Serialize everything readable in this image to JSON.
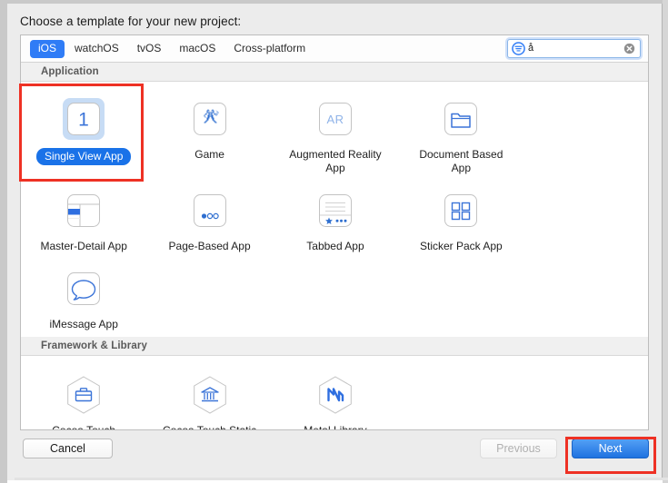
{
  "dialog": {
    "title": "Choose a template for your new project:"
  },
  "platform_tabs": {
    "items": [
      {
        "label": "iOS",
        "selected": true
      },
      {
        "label": "watchOS",
        "selected": false
      },
      {
        "label": "tvOS",
        "selected": false
      },
      {
        "label": "macOS",
        "selected": false
      },
      {
        "label": "Cross-platform",
        "selected": false
      }
    ]
  },
  "search": {
    "value": "å",
    "placeholder": "",
    "filter_icon": "filter-search-icon",
    "clear_icon": "clear-search-icon"
  },
  "sections": [
    {
      "header": "Application",
      "templates": [
        {
          "label": "Single View App",
          "icon": "single-view-app-icon",
          "selected": true
        },
        {
          "label": "Game",
          "icon": "game-icon",
          "selected": false
        },
        {
          "label": "Augmented Reality App",
          "icon": "augmented-reality-app-icon",
          "selected": false
        },
        {
          "label": "Document Based App",
          "icon": "document-based-app-icon",
          "selected": false
        },
        {
          "label": "Master-Detail App",
          "icon": "master-detail-app-icon",
          "selected": false
        },
        {
          "label": "Page-Based App",
          "icon": "page-based-app-icon",
          "selected": false
        },
        {
          "label": "Tabbed App",
          "icon": "tabbed-app-icon",
          "selected": false
        },
        {
          "label": "Sticker Pack App",
          "icon": "sticker-pack-app-icon",
          "selected": false
        },
        {
          "label": "iMessage App",
          "icon": "imessage-app-icon",
          "selected": false
        }
      ]
    },
    {
      "header": "Framework & Library",
      "templates": [
        {
          "label": "Cocoa Touch Framework",
          "icon": "cocoa-touch-framework-icon",
          "selected": false
        },
        {
          "label": "Cocoa Touch Static Library",
          "icon": "cocoa-touch-static-library-icon",
          "selected": false
        },
        {
          "label": "Metal Library",
          "icon": "metal-library-icon",
          "selected": false
        }
      ]
    }
  ],
  "buttons": {
    "cancel": "Cancel",
    "previous": "Previous",
    "next": "Next"
  },
  "annotations": [
    {
      "name": "single-view-app-highlight",
      "color": "#ee3124"
    },
    {
      "name": "next-button-highlight",
      "color": "#ee3124"
    }
  ],
  "colors": {
    "accent_blue": "#1a72e8",
    "tab_selected_blue": "#2f7cf6",
    "annotation_red": "#ee3124",
    "dialog_bg": "#ececec",
    "panel_bg": "#ffffff"
  }
}
